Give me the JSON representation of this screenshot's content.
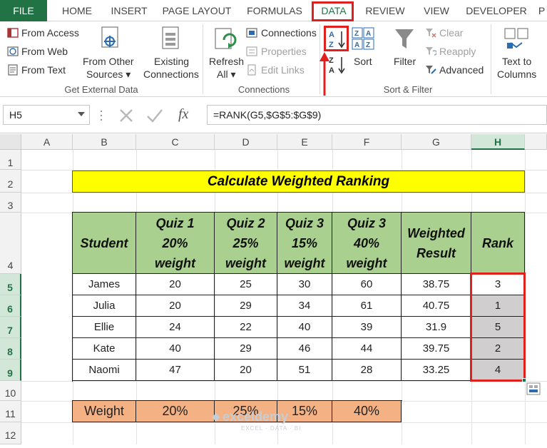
{
  "menu_tabs": [
    "FILE",
    "HOME",
    "INSERT",
    "PAGE LAYOUT",
    "FORMULAS",
    "DATA",
    "REVIEW",
    "VIEW",
    "DEVELOPER",
    "P"
  ],
  "ribbon": {
    "get_external": {
      "from_access": "From Access",
      "from_web": "From Web",
      "from_text": "From Text",
      "from_other_1": "From Other",
      "from_other_2": "Sources ▾",
      "existing_1": "Existing",
      "existing_2": "Connections",
      "group_label": "Get External Data"
    },
    "connections": {
      "refresh_1": "Refresh",
      "refresh_2": "All ▾",
      "connections": "Connections",
      "properties": "Properties",
      "edit_links": "Edit Links",
      "group_label": "Connections"
    },
    "sort_filter": {
      "sort": "Sort",
      "filter": "Filter",
      "clear": "Clear",
      "reapply": "Reapply",
      "advanced": "Advanced",
      "group_label": "Sort & Filter"
    },
    "data_tools": {
      "text_to_1": "Text to",
      "text_to_2": "Columns"
    }
  },
  "formula_bar": {
    "name_box": "H5",
    "formula": "=RANK(G5,$G$5:$G$9)",
    "fx": "fx"
  },
  "columns": [
    "A",
    "B",
    "C",
    "D",
    "E",
    "F",
    "G",
    "H"
  ],
  "rows": [
    "1",
    "2",
    "3",
    "4",
    "5",
    "6",
    "7",
    "8",
    "9",
    "10",
    "11",
    "12"
  ],
  "title": "Calculate Weighted Ranking",
  "table": {
    "headers": [
      "Student",
      "Quiz 1\n20%\nweight",
      "Quiz 2\n25%\nweight",
      "Quiz 3\n15%\nweight",
      "Quiz 3\n40%\nweight",
      "Weighted\nResult",
      "Rank"
    ],
    "rows": [
      [
        "James",
        "20",
        "25",
        "30",
        "60",
        "38.75",
        "3"
      ],
      [
        "Julia",
        "20",
        "29",
        "34",
        "61",
        "40.75",
        "1"
      ],
      [
        "Ellie",
        "24",
        "22",
        "40",
        "39",
        "31.9",
        "5"
      ],
      [
        "Kate",
        "40",
        "29",
        "46",
        "44",
        "39.75",
        "2"
      ],
      [
        "Naomi",
        "47",
        "20",
        "51",
        "28",
        "33.25",
        "4"
      ]
    ]
  },
  "weights": [
    "Weight",
    "20%",
    "25%",
    "15%",
    "40%"
  ],
  "watermark": {
    "brand": "exceldemy",
    "tagline": "EXCEL · DATA · BI"
  },
  "colors": {
    "excel_green": "#217346",
    "header_green": "#a9d08e",
    "title_yellow": "#ffff00",
    "weight_orange": "#f4b183",
    "highlight_red": "#e0201c",
    "rank_grey": "#d0cece"
  }
}
